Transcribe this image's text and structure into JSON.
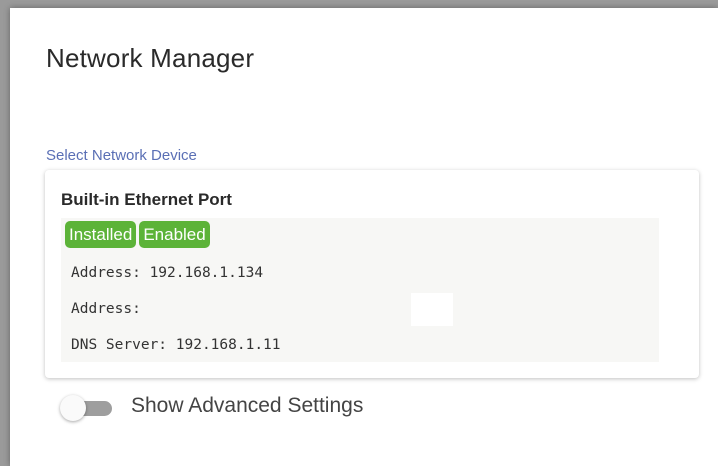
{
  "header": {
    "title": "Network Manager"
  },
  "device_select": {
    "label": "Select Network Device",
    "device": {
      "name": "Built-in Ethernet Port",
      "badges": [
        "Installed",
        "Enabled"
      ],
      "badge_color": "#5cb338",
      "details": [
        "Address: 192.168.1.134",
        "Address:",
        "DNS Server: 192.168.1.11"
      ]
    }
  },
  "advanced_toggle": {
    "label": "Show Advanced Settings",
    "checked": false
  }
}
